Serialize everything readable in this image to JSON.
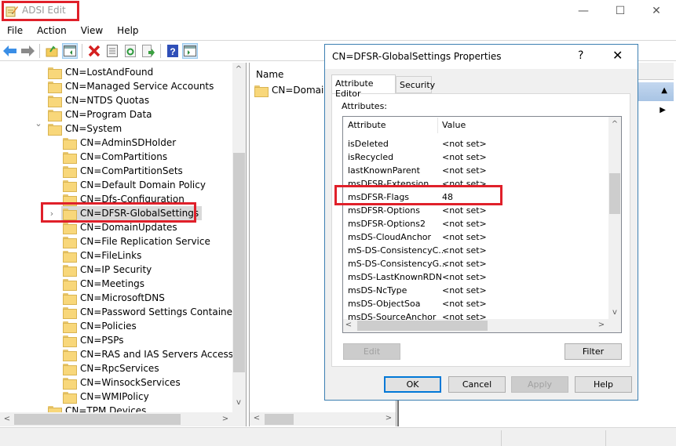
{
  "window": {
    "title": "ADSI Edit",
    "icon": "notepad-pencil-icon",
    "controls": {
      "minimize": "—",
      "maximize": "☐",
      "close": "✕"
    }
  },
  "menubar": [
    "File",
    "Action",
    "View",
    "Help"
  ],
  "toolbar": {
    "buttons": [
      {
        "name": "back-button",
        "icon": "arrow-left-icon"
      },
      {
        "name": "forward-button",
        "icon": "arrow-right-icon"
      },
      {
        "name": "up-folder-button",
        "icon": "folder-up-icon"
      },
      {
        "name": "show-hide-console-tree-button",
        "icon": "console-tree-icon"
      },
      {
        "name": "delete-button",
        "icon": "delete-x-icon"
      },
      {
        "name": "properties-button",
        "icon": "properties-icon"
      },
      {
        "name": "refresh-button",
        "icon": "refresh-icon"
      },
      {
        "name": "export-list-button",
        "icon": "export-icon"
      },
      {
        "name": "help-button",
        "icon": "help-icon"
      },
      {
        "name": "show-hide-action-pane-button",
        "icon": "action-pane-icon"
      }
    ]
  },
  "tree": {
    "items": [
      {
        "label": "CN=LostAndFound",
        "level": 1
      },
      {
        "label": "CN=Managed Service Accounts",
        "level": 1
      },
      {
        "label": "CN=NTDS Quotas",
        "level": 1
      },
      {
        "label": "CN=Program Data",
        "level": 1
      },
      {
        "label": "CN=System",
        "level": 1,
        "expanded": true
      },
      {
        "label": "CN=AdminSDHolder",
        "level": 2
      },
      {
        "label": "CN=ComPartitions",
        "level": 2
      },
      {
        "label": "CN=ComPartitionSets",
        "level": 2
      },
      {
        "label": "CN=Default Domain Policy",
        "level": 2
      },
      {
        "label": "CN=Dfs-Configuration",
        "level": 2
      },
      {
        "label": "CN=DFSR-GlobalSettings",
        "level": 2,
        "selected": true,
        "collapsed": true
      },
      {
        "label": "CN=DomainUpdates",
        "level": 2
      },
      {
        "label": "CN=File Replication Service",
        "level": 2
      },
      {
        "label": "CN=FileLinks",
        "level": 2
      },
      {
        "label": "CN=IP Security",
        "level": 2
      },
      {
        "label": "CN=Meetings",
        "level": 2
      },
      {
        "label": "CN=MicrosoftDNS",
        "level": 2
      },
      {
        "label": "CN=Password Settings Container",
        "level": 2
      },
      {
        "label": "CN=Policies",
        "level": 2
      },
      {
        "label": "CN=PSPs",
        "level": 2
      },
      {
        "label": "CN=RAS and IAS Servers Access Che",
        "level": 2
      },
      {
        "label": "CN=RpcServices",
        "level": 2
      },
      {
        "label": "CN=WinsockServices",
        "level": 2
      },
      {
        "label": "CN=WMIPolicy",
        "level": 2
      },
      {
        "label": "CN=TPM Devices",
        "level": 1
      }
    ]
  },
  "list": {
    "header": "Name",
    "items": [
      "CN=Domain S"
    ]
  },
  "dialog": {
    "title": "CN=DFSR-GlobalSettings Properties",
    "help": "?",
    "close": "✕",
    "tabs": [
      "Attribute Editor",
      "Security"
    ],
    "active_tab": "Attribute Editor",
    "attributes_label": "Attributes:",
    "columns": [
      "Attribute",
      "Value"
    ],
    "rows": [
      {
        "attr": "isDeleted",
        "value": "<not set>"
      },
      {
        "attr": "isRecycled",
        "value": "<not set>"
      },
      {
        "attr": "lastKnownParent",
        "value": "<not set>"
      },
      {
        "attr": "msDFSR-Extension",
        "value": "<not set>"
      },
      {
        "attr": "msDFSR-Flags",
        "value": "48"
      },
      {
        "attr": "msDFSR-Options",
        "value": "<not set>"
      },
      {
        "attr": "msDFSR-Options2",
        "value": "<not set>"
      },
      {
        "attr": "msDS-CloudAnchor",
        "value": "<not set>"
      },
      {
        "attr": "mS-DS-ConsistencyC...",
        "value": "<not set>"
      },
      {
        "attr": "mS-DS-ConsistencyG...",
        "value": "<not set>"
      },
      {
        "attr": "msDS-LastKnownRDN",
        "value": "<not set>"
      },
      {
        "attr": "msDS-NcType",
        "value": "<not set>"
      },
      {
        "attr": "msDS-ObjectSoa",
        "value": "<not set>"
      },
      {
        "attr": "msDS-SourceAnchor",
        "value": "<not set>"
      }
    ],
    "buttons": {
      "edit": "Edit",
      "filter": "Filter",
      "ok": "OK",
      "cancel": "Cancel",
      "apply": "Apply",
      "help": "Help"
    }
  },
  "colors": {
    "highlight_annotation": "#e0202a",
    "dialog_border": "#3c7fb1",
    "default_button_border": "#0078d7",
    "action_header": "#a8c4e4"
  }
}
